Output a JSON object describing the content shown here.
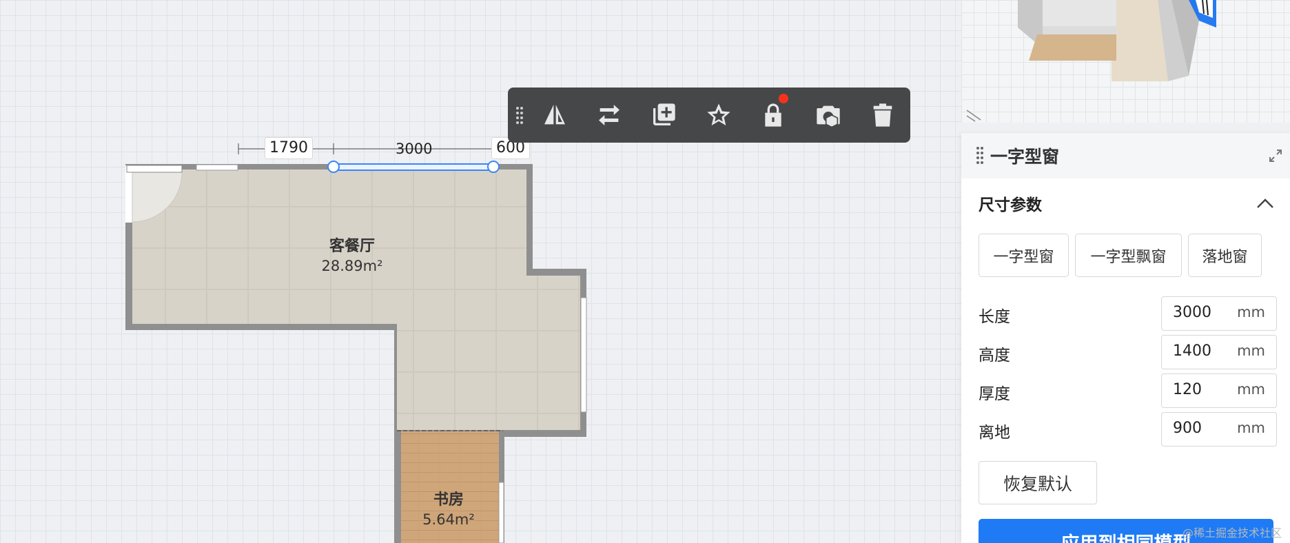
{
  "toolbar": {
    "items": [
      {
        "icon": "flip-icon"
      },
      {
        "icon": "swap-icon"
      },
      {
        "icon": "duplicate-icon"
      },
      {
        "icon": "star-icon"
      },
      {
        "icon": "lock-icon"
      },
      {
        "icon": "camera-icon"
      },
      {
        "icon": "trash-icon"
      }
    ]
  },
  "dimensions": {
    "left": "1790",
    "middle": "3000",
    "right": "600"
  },
  "rooms": {
    "living": {
      "name": "客餐厅",
      "area": "28.89m²"
    },
    "study": {
      "name": "书房",
      "area": "5.64m²"
    }
  },
  "panel": {
    "title": "一字型窗",
    "section_title": "尺寸参数",
    "types": [
      "一字型窗",
      "一字型飘窗",
      "落地窗"
    ],
    "params": [
      {
        "label": "长度",
        "value": "3000",
        "unit": "mm"
      },
      {
        "label": "高度",
        "value": "1400",
        "unit": "mm"
      },
      {
        "label": "厚度",
        "value": "120",
        "unit": "mm"
      },
      {
        "label": "离地",
        "value": "900",
        "unit": "mm"
      }
    ],
    "reset_label": "恢复默认",
    "apply_label": "应用到相同模型"
  },
  "watermark": "@稀土掘金技术社区",
  "colors": {
    "accent": "#1e7bf5",
    "toolbar_bg": "#464749",
    "badge": "#f5331d"
  }
}
